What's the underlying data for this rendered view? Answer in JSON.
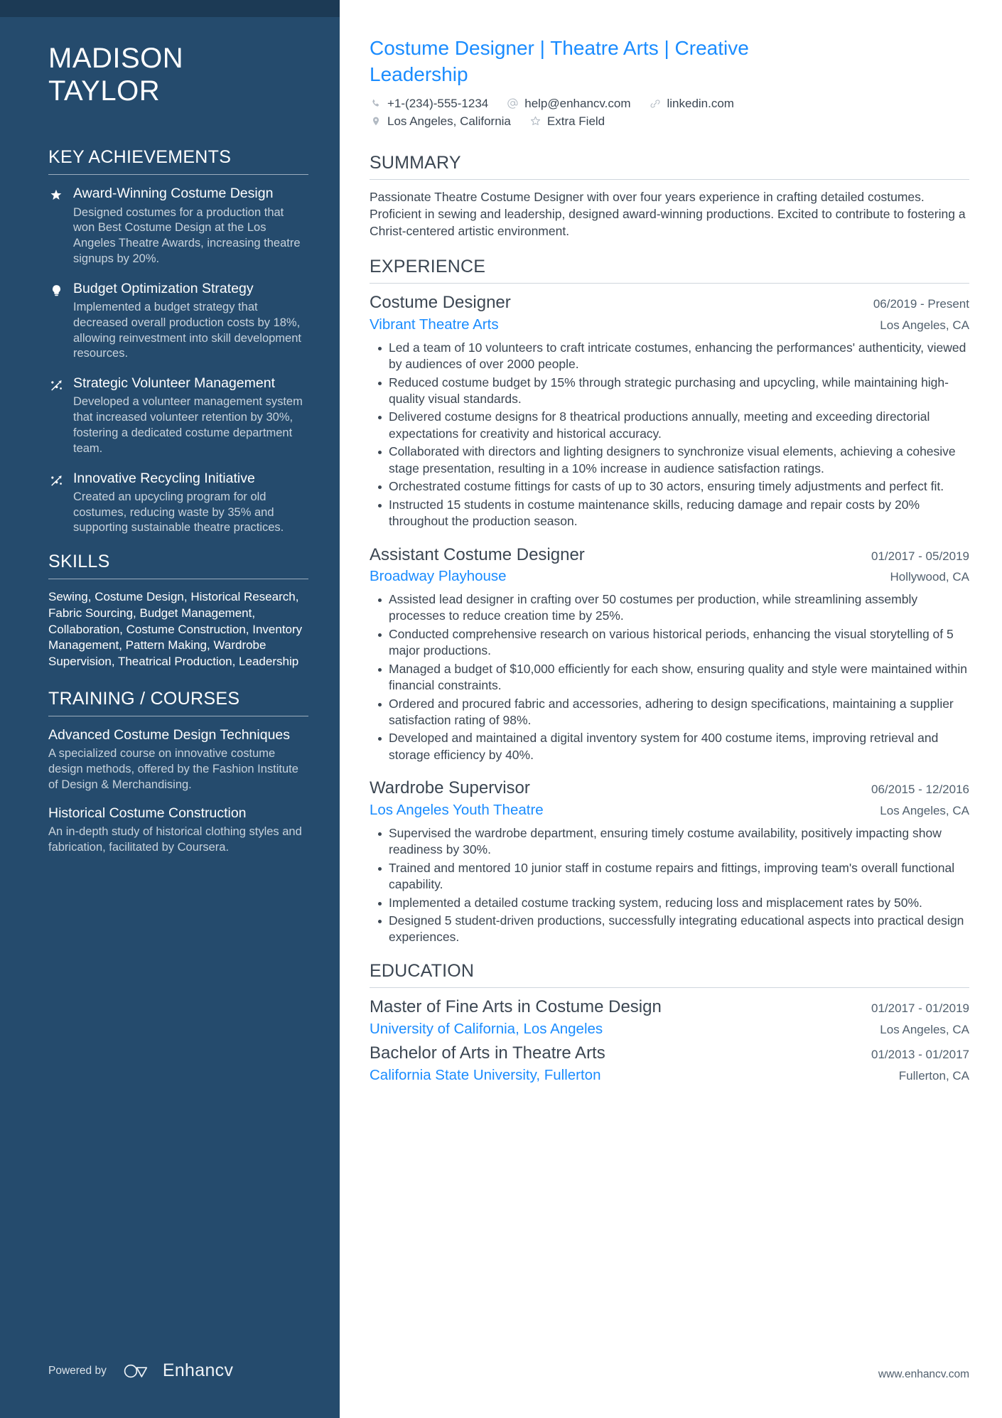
{
  "sidebar": {
    "name_lines": [
      "MADISON",
      "TAYLOR"
    ],
    "achievements_heading": "KEY ACHIEVEMENTS",
    "achievements": [
      {
        "icon": "star-icon",
        "title": "Award-Winning Costume Design",
        "desc": "Designed costumes for a production that won Best Costume Design at the Los Angeles Theatre Awards, increasing theatre signups by 20%."
      },
      {
        "icon": "lightbulb-icon",
        "title": "Budget Optimization Strategy",
        "desc": "Implemented a budget strategy that decreased overall production costs by 18%, allowing reinvestment into skill development resources."
      },
      {
        "icon": "growth-arrow-icon",
        "title": "Strategic Volunteer Management",
        "desc": "Developed a volunteer management system that increased volunteer retention by 30%, fostering a dedicated costume department team."
      },
      {
        "icon": "growth-arrow-icon",
        "title": "Innovative Recycling Initiative",
        "desc": "Created an upcycling program for old costumes, reducing waste by 35% and supporting sustainable theatre practices."
      }
    ],
    "skills_heading": "SKILLS",
    "skills_text": "Sewing, Costume Design, Historical Research, Fabric Sourcing, Budget Management, Collaboration, Costume Construction, Inventory Management, Pattern Making, Wardrobe Supervision, Theatrical Production, Leadership",
    "training_heading": "TRAINING / COURSES",
    "courses": [
      {
        "title": "Advanced Costume Design Techniques",
        "desc": "A specialized course on innovative costume design methods, offered by the Fashion Institute of Design & Merchandising."
      },
      {
        "title": "Historical Costume Construction",
        "desc": "An in-depth study of historical clothing styles and fabrication, facilitated by Coursera."
      }
    ],
    "footer": {
      "powered_by": "Powered by",
      "brand": "Enhancv"
    }
  },
  "main": {
    "headline": "Costume Designer | Theatre Arts | Creative Leadership",
    "contact_row_1": [
      {
        "icon": "phone-icon",
        "text": "+1-(234)-555-1234"
      },
      {
        "icon": "at-email-icon",
        "text": "help@enhancv.com"
      },
      {
        "icon": "link-icon",
        "text": "linkedin.com"
      }
    ],
    "contact_row_2": [
      {
        "icon": "location-pin-icon",
        "text": "Los Angeles, California"
      },
      {
        "icon": "star-outline-icon",
        "text": "Extra Field"
      }
    ],
    "summary_heading": "SUMMARY",
    "summary_text": "Passionate Theatre Costume Designer with over four years experience in crafting detailed costumes. Proficient in sewing and leadership, designed award-winning productions. Excited to contribute to fostering a Christ-centered artistic environment.",
    "experience_heading": "EXPERIENCE",
    "experience": [
      {
        "title": "Costume Designer",
        "date": "06/2019 - Present",
        "org": "Vibrant Theatre Arts",
        "location": "Los Angeles, CA",
        "bullets": [
          "Led a team of 10 volunteers to craft intricate costumes, enhancing the performances' authenticity, viewed by audiences of over 2000 people.",
          "Reduced costume budget by 15% through strategic purchasing and upcycling, while maintaining high-quality visual standards.",
          "Delivered costume designs for 8 theatrical productions annually, meeting and exceeding directorial expectations for creativity and historical accuracy.",
          "Collaborated with directors and lighting designers to synchronize visual elements, achieving a cohesive stage presentation, resulting in a 10% increase in audience satisfaction ratings.",
          "Orchestrated costume fittings for casts of up to 30 actors, ensuring timely adjustments and perfect fit.",
          "Instructed 15 students in costume maintenance skills, reducing damage and repair costs by 20% throughout the production season."
        ]
      },
      {
        "title": "Assistant Costume Designer",
        "date": "01/2017 - 05/2019",
        "org": "Broadway Playhouse",
        "location": "Hollywood, CA",
        "bullets": [
          "Assisted lead designer in crafting over 50 costumes per production, while streamlining assembly processes to reduce creation time by 25%.",
          "Conducted comprehensive research on various historical periods, enhancing the visual storytelling of 5 major productions.",
          "Managed a budget of $10,000 efficiently for each show, ensuring quality and style were maintained within financial constraints.",
          "Ordered and procured fabric and accessories, adhering to design specifications, maintaining a supplier satisfaction rating of 98%.",
          "Developed and maintained a digital inventory system for 400 costume items, improving retrieval and storage efficiency by 40%."
        ]
      },
      {
        "title": "Wardrobe Supervisor",
        "date": "06/2015 - 12/2016",
        "org": "Los Angeles Youth Theatre",
        "location": "Los Angeles, CA",
        "bullets": [
          "Supervised the wardrobe department, ensuring timely costume availability, positively impacting show readiness by 30%.",
          "Trained and mentored 10 junior staff in costume repairs and fittings, improving team's overall functional capability.",
          "Implemented a detailed costume tracking system, reducing loss and misplacement rates by 50%.",
          "Designed 5 student-driven productions, successfully integrating educational aspects into practical design experiences."
        ]
      }
    ],
    "education_heading": "EDUCATION",
    "education": [
      {
        "title": "Master of Fine Arts in Costume Design",
        "date": "01/2017 - 01/2019",
        "org": "University of California, Los Angeles",
        "location": "Los Angeles, CA"
      },
      {
        "title": "Bachelor of Arts in Theatre Arts",
        "date": "01/2013 - 01/2017",
        "org": "California State University, Fullerton",
        "location": "Fullerton, CA"
      }
    ],
    "footer_url": "www.enhancv.com"
  },
  "colors": {
    "sidebar_bg": "#254b6d",
    "sidebar_topbar": "#1c3a55",
    "accent_blue": "#1a8cff",
    "body_text": "#3b4652"
  }
}
